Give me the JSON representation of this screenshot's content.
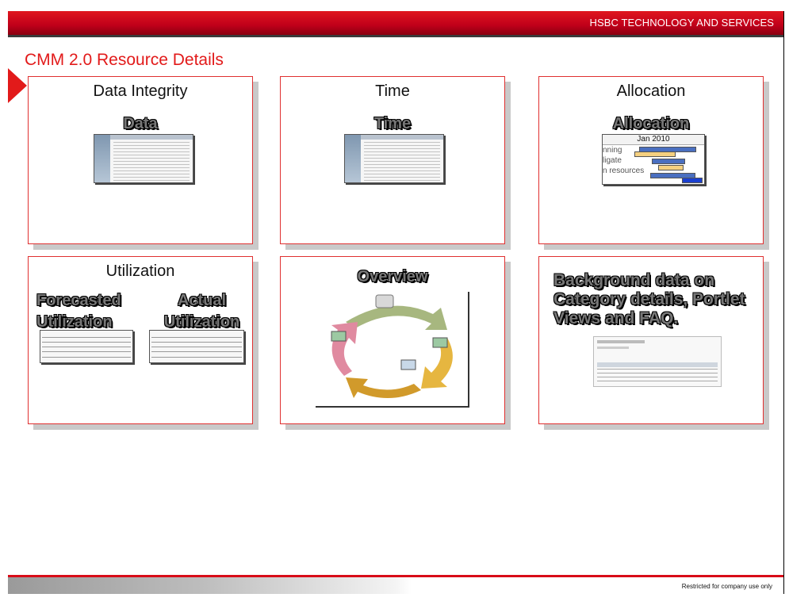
{
  "header": {
    "company": "HSBC TECHNOLOGY AND SERVICES"
  },
  "page": {
    "title": "CMM 2.0 Resource Details"
  },
  "panels": {
    "data_integrity": {
      "title": "Data Integrity",
      "subtitle": "Data"
    },
    "time": {
      "title": "Time",
      "subtitle": "Time"
    },
    "allocation": {
      "title": "Allocation",
      "subtitle": "Allocation",
      "chart_header": "Jan 2010",
      "rows": [
        "nning",
        "ligate",
        "n resources"
      ]
    },
    "utilization": {
      "title": "Utilization",
      "forecasted": "Forecasted Utilization",
      "actual": "Actual Utilization"
    },
    "overview": {
      "subtitle": "Overview"
    },
    "background": {
      "text": "Background data on Category details, Portlet Views and FAQ."
    }
  },
  "footer": {
    "restricted": "Restricted for company use only"
  },
  "colors": {
    "brand_red": "#e21a1a",
    "header_red": "#c0001a",
    "panel_border": "#e03030"
  }
}
